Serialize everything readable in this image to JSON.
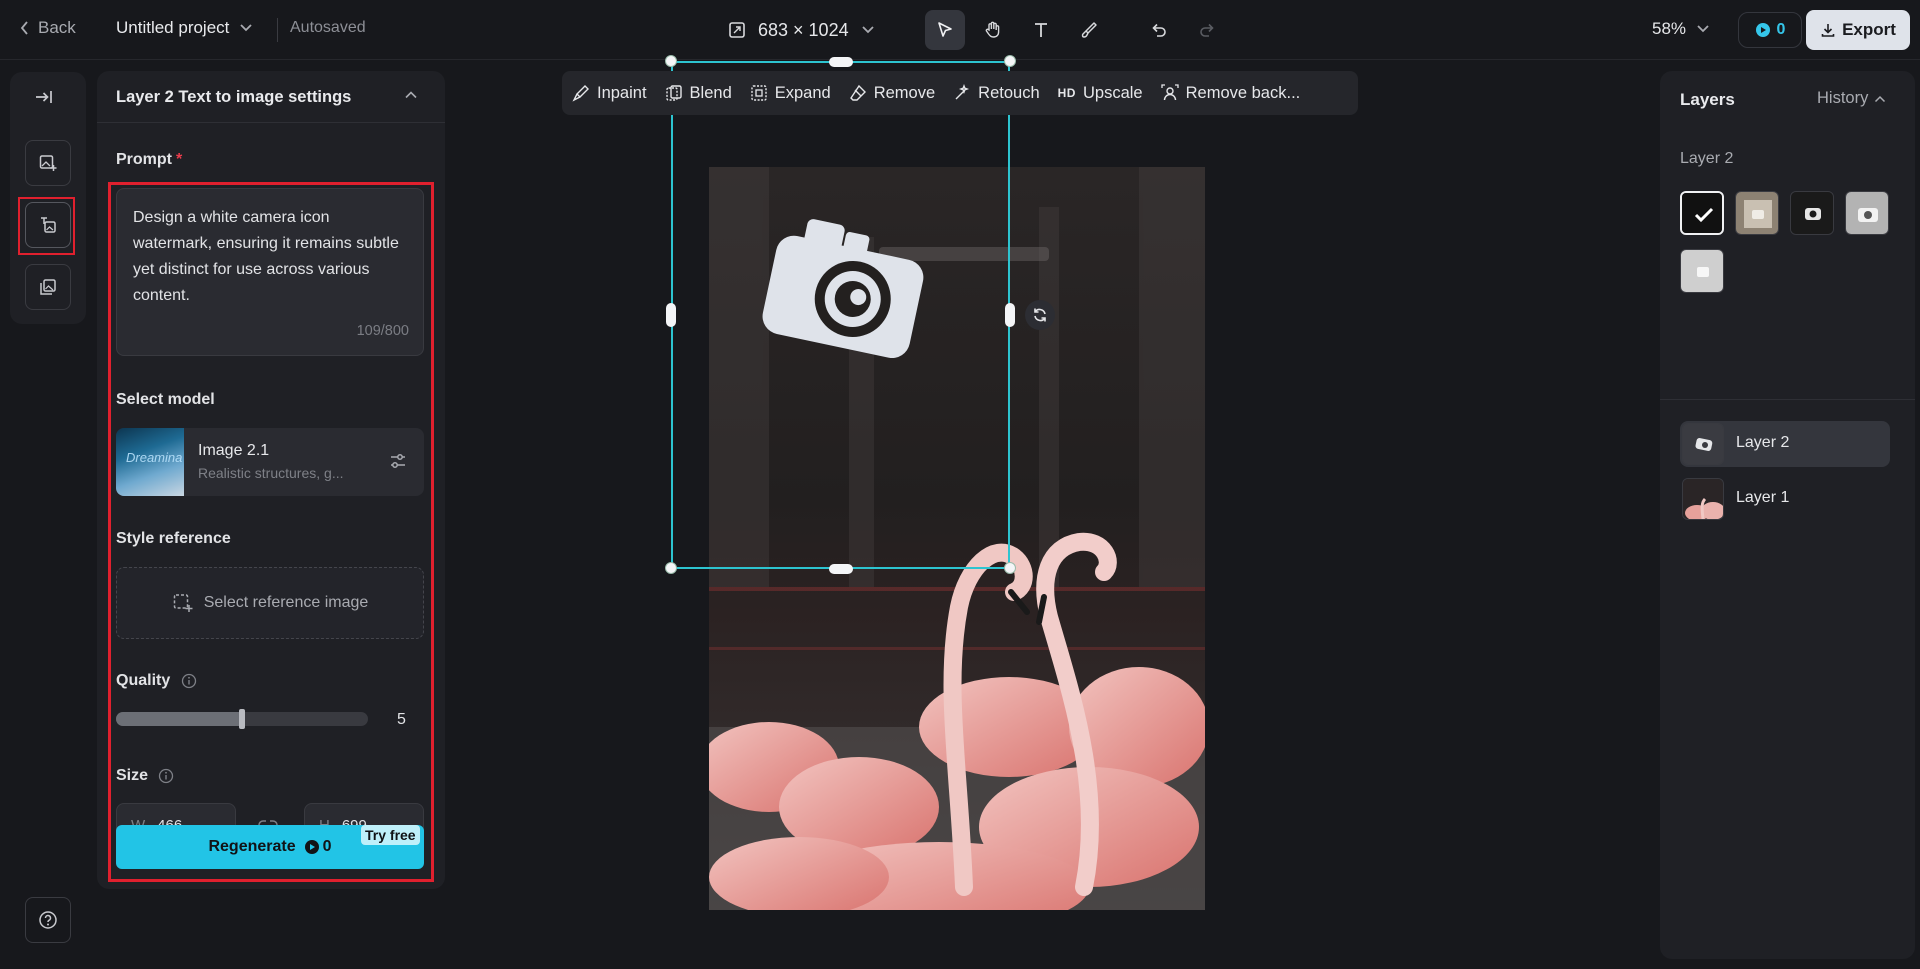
{
  "topbar": {
    "back_label": "Back",
    "project_title": "Untitled project",
    "save_status": "Autosaved",
    "canvas_size": "683 × 1024",
    "zoom": "58%",
    "credits": "0",
    "export_label": "Export"
  },
  "panel": {
    "title": "Layer 2 Text to image settings",
    "prompt_label": "Prompt",
    "prompt_required": "*",
    "prompt_value": "Design a white camera icon watermark, ensuring it remains subtle yet distinct for use across various content.",
    "prompt_count": "109/800",
    "model_label": "Select model",
    "model_name": "Image 2.1",
    "model_desc": "Realistic structures, g...",
    "model_thumb_text": "Dreamina",
    "style_label": "Style reference",
    "style_button": "Select reference image",
    "quality_label": "Quality",
    "quality_value": "5",
    "quality_fraction": 0.5,
    "size_label": "Size",
    "width_prefix": "W",
    "width_value": "466",
    "height_prefix": "H",
    "height_value": "699",
    "regenerate_label": "Regenerate",
    "regenerate_cost": "0",
    "try_free": "Try free"
  },
  "canvas_toolbar": [
    {
      "label": "Inpaint",
      "icon": "inpaint-icon"
    },
    {
      "label": "Blend",
      "icon": "blend-icon"
    },
    {
      "label": "Expand",
      "icon": "expand-icon"
    },
    {
      "label": "Remove",
      "icon": "eraser-icon"
    },
    {
      "label": "Retouch",
      "icon": "retouch-icon"
    },
    {
      "label": "Upscale",
      "icon": "hd-icon",
      "badge": "HD"
    },
    {
      "label": "Remove back...",
      "icon": "remove-background-icon"
    }
  ],
  "layers_panel": {
    "tab_layers": "Layers",
    "tab_history": "History",
    "section_label": "Layer 2",
    "layers": [
      {
        "name": "Layer 2",
        "active": true
      },
      {
        "name": "Layer 1",
        "active": false
      }
    ]
  },
  "colors": {
    "accent": "#22c4e6",
    "selection": "#2dc4d0",
    "highlight": "#e0202e"
  }
}
